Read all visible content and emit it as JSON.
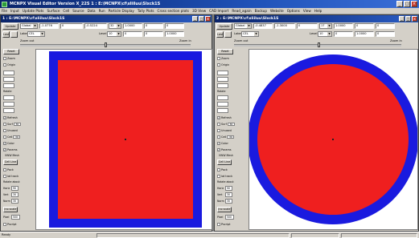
{
  "app": {
    "title": "MCNPX Visual Editor Version X_22S   1 : E:\\MCNPX\\cf\\sliiluu\\Slxck1S",
    "controls": [
      "_",
      "□",
      "×"
    ]
  },
  "menu": [
    "File",
    "Input",
    "Update Plots",
    "Surface",
    "Cell",
    "Source",
    "Data",
    "Run",
    "Particle Display",
    "Tally Plots",
    "Cross section plots",
    "3D View",
    "CAD Import",
    "Read_again",
    "Backup",
    "Website",
    "Options",
    "View",
    "Help"
  ],
  "left_window": {
    "title": "1 : E:\\MCNPX\\cf\\sliiluu\\Slxck1S",
    "update_label": "Update",
    "view_combo": "Global",
    "origin_x": "-1.0776",
    "origin_y": "0",
    "origin_z": "-0.5224",
    "extent_combo": "32",
    "ext1": "1.0000",
    "ext2": "0",
    "ext3": "0",
    "last_label": "Last",
    "label_text": "Label",
    "label_combo": "CEL",
    "level_text": "Level",
    "level_combo": "10",
    "lv1": "0",
    "lv2": "0",
    "lv3": "1.0000",
    "zoom_out": "Zoom out",
    "zoom_in": "Zoom in"
  },
  "right_window": {
    "title": "2 : E:\\MCNPX\\cf\\sliiluu\\Slxck1S",
    "update_label": "Update",
    "view_combo": "Global",
    "origin_x": "-0.4837",
    "origin_y": "-1.3000",
    "origin_z": "0",
    "extent_combo": "17",
    "ext1": "1.0000",
    "ext2": "0",
    "ext3": "0",
    "last_label": "Last",
    "label_text": "Label",
    "label_combo": "CEL",
    "level_text": "Level",
    "level_combo": "10",
    "lv1": "0",
    "lv2": "1.0000",
    "lv3": "0",
    "zoom_out": "Zoom out",
    "zoom_in": "Zoom in"
  },
  "side_panel": {
    "reset": "Reset",
    "zoom": "Zoom",
    "origin": "Origin",
    "rotate": "Rotate",
    "refresh": "Refresh",
    "surf": "Surf",
    "surf_val": "30",
    "unused": "Unused",
    "cell": "Cell",
    "cell_val": "30",
    "color": "Color",
    "params": "Params",
    "vwmark": "VWW Mesh",
    "cell_line": "Cell Line",
    "pack": "Pack",
    "lat_track": "lat track",
    "rotate_about": "Rotate about",
    "hor": "Horiz",
    "hor_val": "90",
    "vert": "Vert",
    "vert_val": "30",
    "norm": "Norm",
    "norm_val": "30",
    "hor_scale": "(no scale)",
    "pixel": "Pixel",
    "pixel_val": "500",
    "pscript": "Pscript"
  },
  "status": {
    "text": "Ready"
  },
  "colors": {
    "outer_blue": "#1a1adf",
    "inner_red": "#ef1f1f",
    "title_blue": "#0a246a"
  }
}
